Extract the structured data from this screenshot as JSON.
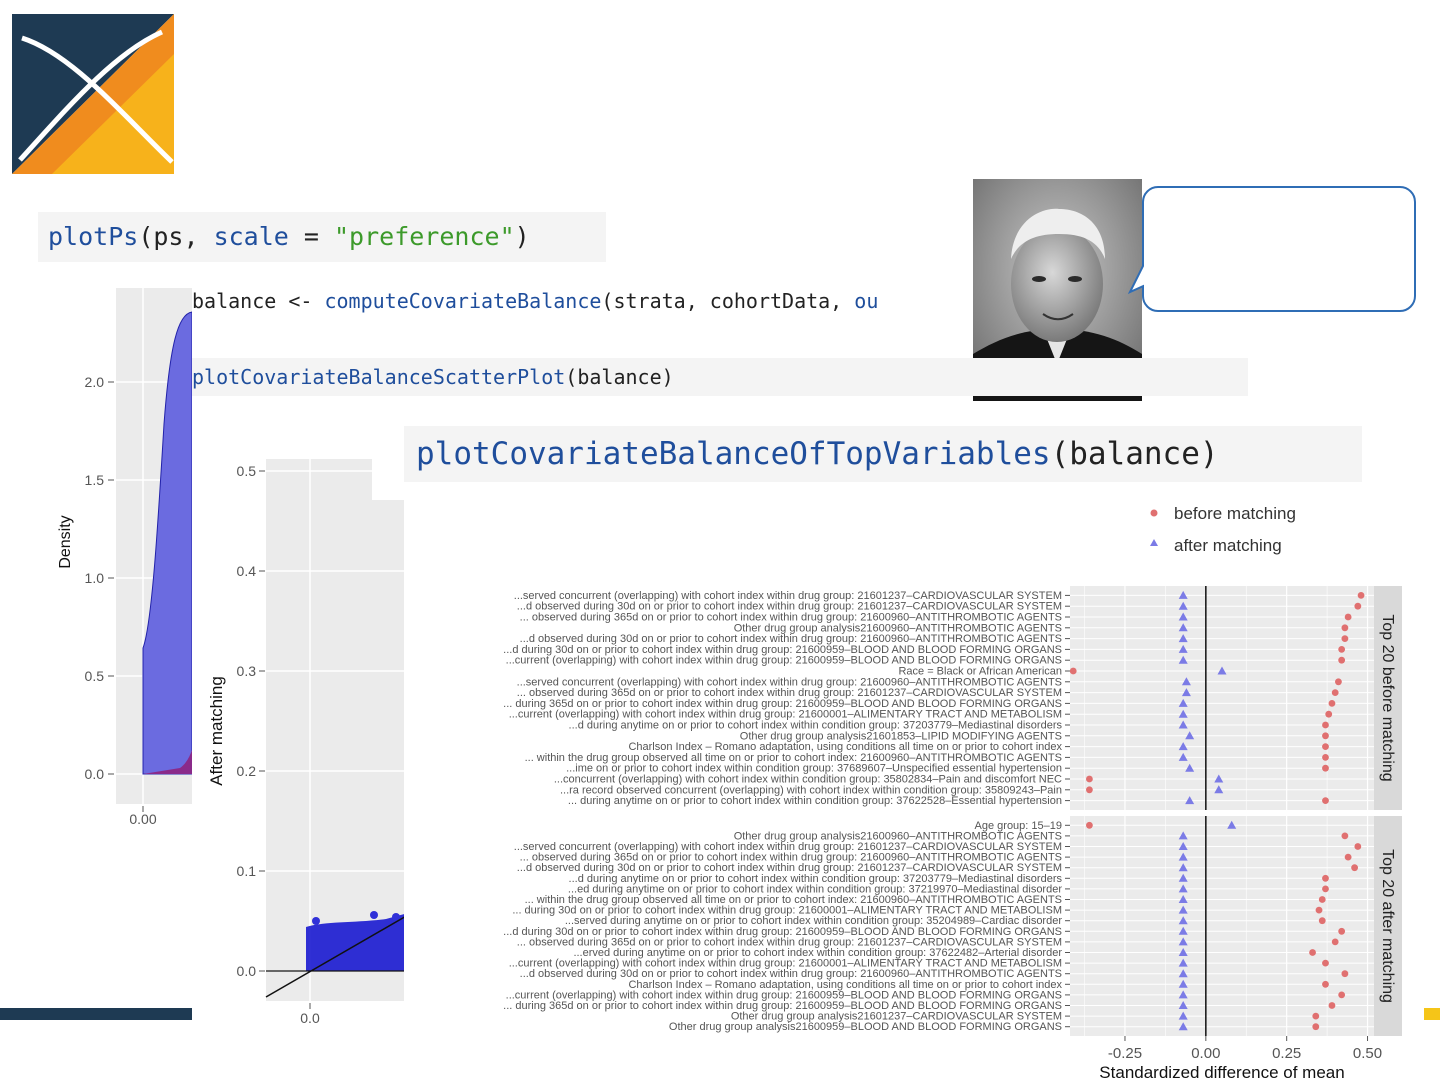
{
  "code": {
    "plotps_fn": "plotPs",
    "plotps_args_open": "(ps, ",
    "plotps_kw": "scale",
    "plotps_eq": " = ",
    "plotps_str": "\"preference\"",
    "plotps_close": ")",
    "balance_prefix": "balance <- ",
    "balance_fn": "computeCovariateBalance",
    "balance_args": "(strata, cohortData, ",
    "balance_tail": "ou",
    "scatter_fn": "plotCovariateBalanceScatterPlot",
    "scatter_args": "(balance)",
    "top_fn": "plotCovariateBalanceOfTopVariables",
    "top_args": "(balance)"
  },
  "density_plot": {
    "ylabel": "Density",
    "y_ticks": [
      "0.0",
      "0.5",
      "1.0",
      "1.5",
      "2.0"
    ],
    "x_ticks": [
      "0.00"
    ]
  },
  "scatter_plot": {
    "ylabel": "After matching",
    "y_ticks": [
      "0.0",
      "0.1",
      "0.2",
      "0.3",
      "0.4",
      "0.5"
    ],
    "x_ticks": [
      "0.0"
    ]
  },
  "colors": {
    "logo_navy": "#1e3a53",
    "logo_orange": "#f08c1e",
    "logo_yellow": "#f7b21b",
    "density_fill": "#6b6be0",
    "scatter_points": "#1a1ad0",
    "before_color": "#e07070",
    "after_color": "#7b7be6",
    "panel_bg": "#ebebeb",
    "strip_bg": "#d9d9d9",
    "accent_yellow": "#f5c518"
  },
  "chart_data": {
    "type": "scatter",
    "title": "",
    "xlabel": "Standardized difference of mean",
    "ylabel": "",
    "xlim": [
      -0.42,
      0.52
    ],
    "x_ticks": [
      "-0.25",
      "0.00",
      "0.25",
      "0.50"
    ],
    "legend": {
      "placement": "top-right",
      "entries": [
        "before matching",
        "after matching"
      ]
    },
    "facets": [
      {
        "strip": "Top 20 before matching",
        "labels": [
          "...served concurrent (overlapping) with cohort index within drug group:  21601237–CARDIOVASCULAR SYSTEM",
          "...d observed during 30d on or prior to cohort index within drug group:  21601237–CARDIOVASCULAR SYSTEM",
          "... observed during 365d on or prior to cohort index within drug group:  21600960–ANTITHROMBOTIC AGENTS",
          "Other drug group analysis21600960–ANTITHROMBOTIC AGENTS",
          "...d observed during 30d on or prior to cohort index within drug group:  21600960–ANTITHROMBOTIC AGENTS",
          "...d during 30d on or prior to cohort index within drug group:  21600959–BLOOD AND BLOOD FORMING ORGANS",
          "...current (overlapping) with cohort index within drug group:  21600959–BLOOD AND BLOOD FORMING ORGANS",
          "Race = Black or African American",
          "...served concurrent (overlapping) with cohort index within drug group:  21600960–ANTITHROMBOTIC AGENTS",
          "... observed during 365d on or prior to cohort index within drug group:  21601237–CARDIOVASCULAR SYSTEM",
          "... during 365d on or prior to cohort index within drug group:  21600959–BLOOD AND BLOOD FORMING ORGANS",
          "...current (overlapping) with cohort index within drug group:  21600001–ALIMENTARY TRACT AND METABOLISM",
          "...d during anytime on or prior to cohort index within condition group:  37203779–Mediastinal disorders",
          "Other drug group analysis21601853–LIPID MODIFYING AGENTS",
          "Charlson Index – Romano adaptation, using conditions all time on or prior to cohort index",
          "... within the drug group observed all time on or prior to cohort index:  21600960–ANTITHROMBOTIC AGENTS",
          "...ime on or prior to cohort index within condition group:  37689607–Unspecified essential hypertension",
          "...concurrent (overlapping) with cohort index within condition group:  35802834–Pain and discomfort NEC",
          "...ra record observed concurrent (overlapping) with cohort index within condition group:  35809243–Pain",
          "... during anytime on or prior to cohort index within condition group:  37622528–Essential hypertension"
        ],
        "before": [
          0.48,
          0.47,
          0.44,
          0.43,
          0.43,
          0.42,
          0.42,
          -0.41,
          0.41,
          0.4,
          0.39,
          0.38,
          0.37,
          0.37,
          0.37,
          0.37,
          0.37,
          -0.36,
          -0.36,
          0.37
        ],
        "after": [
          -0.07,
          -0.07,
          -0.07,
          -0.07,
          -0.07,
          -0.07,
          -0.07,
          0.05,
          -0.06,
          -0.06,
          -0.07,
          -0.07,
          -0.07,
          -0.05,
          -0.07,
          -0.07,
          -0.05,
          0.04,
          0.04,
          -0.05
        ]
      },
      {
        "strip": "Top 20 after matching",
        "labels": [
          "Age group: 15–19",
          "Other drug group analysis21600960–ANTITHROMBOTIC AGENTS",
          "...served concurrent (overlapping) with cohort index within drug group:  21601237–CARDIOVASCULAR SYSTEM",
          "... observed during 365d on or prior to cohort index within drug group:  21600960–ANTITHROMBOTIC AGENTS",
          "...d observed during 30d on or prior to cohort index within drug group:  21601237–CARDIOVASCULAR SYSTEM",
          "...d during anytime on or prior to cohort index within condition group:  37203779–Mediastinal disorders",
          "...ed during anytime on or prior to cohort index within condition group:  37219970–Mediastinal disorder",
          "... within the drug group observed all time on or prior to cohort index:  21600960–ANTITHROMBOTIC AGENTS",
          "... during 30d on or prior to cohort index within drug group:  21600001–ALIMENTARY TRACT AND METABOLISM",
          "...served during anytime on or prior to cohort index within condition group:  35204989–Cardiac disorder",
          "...d during 30d on or prior to cohort index within drug group:  21600959–BLOOD AND BLOOD FORMING ORGANS",
          "... observed during 365d on or prior to cohort index within drug group:  21601237–CARDIOVASCULAR SYSTEM",
          "...erved during anytime on or prior to cohort index within condition group:  37622482–Arterial disorder",
          "...current (overlapping) with cohort index within drug group:  21600001–ALIMENTARY TRACT AND METABOLISM",
          "...d observed during 30d on or prior to cohort index within drug group:  21600960–ANTITHROMBOTIC AGENTS",
          "Charlson Index – Romano adaptation, using conditions all time on or prior to cohort index",
          "...current (overlapping) with cohort index within drug group:  21600959–BLOOD AND BLOOD FORMING ORGANS",
          "... during 365d on or prior to cohort index within drug group:  21600959–BLOOD AND BLOOD FORMING ORGANS",
          "Other drug group analysis21601237–CARDIOVASCULAR SYSTEM",
          "Other drug group analysis21600959–BLOOD AND BLOOD FORMING ORGANS"
        ],
        "before": [
          -0.36,
          0.43,
          0.47,
          0.44,
          0.46,
          0.37,
          0.37,
          0.36,
          0.35,
          0.36,
          0.42,
          0.4,
          0.33,
          0.37,
          0.43,
          0.37,
          0.42,
          0.39,
          0.34,
          0.34
        ],
        "after": [
          0.08,
          -0.07,
          -0.07,
          -0.07,
          -0.07,
          -0.07,
          -0.07,
          -0.07,
          -0.07,
          -0.07,
          -0.07,
          -0.07,
          -0.07,
          -0.07,
          -0.07,
          -0.07,
          -0.07,
          -0.07,
          -0.07,
          -0.07
        ]
      }
    ]
  }
}
